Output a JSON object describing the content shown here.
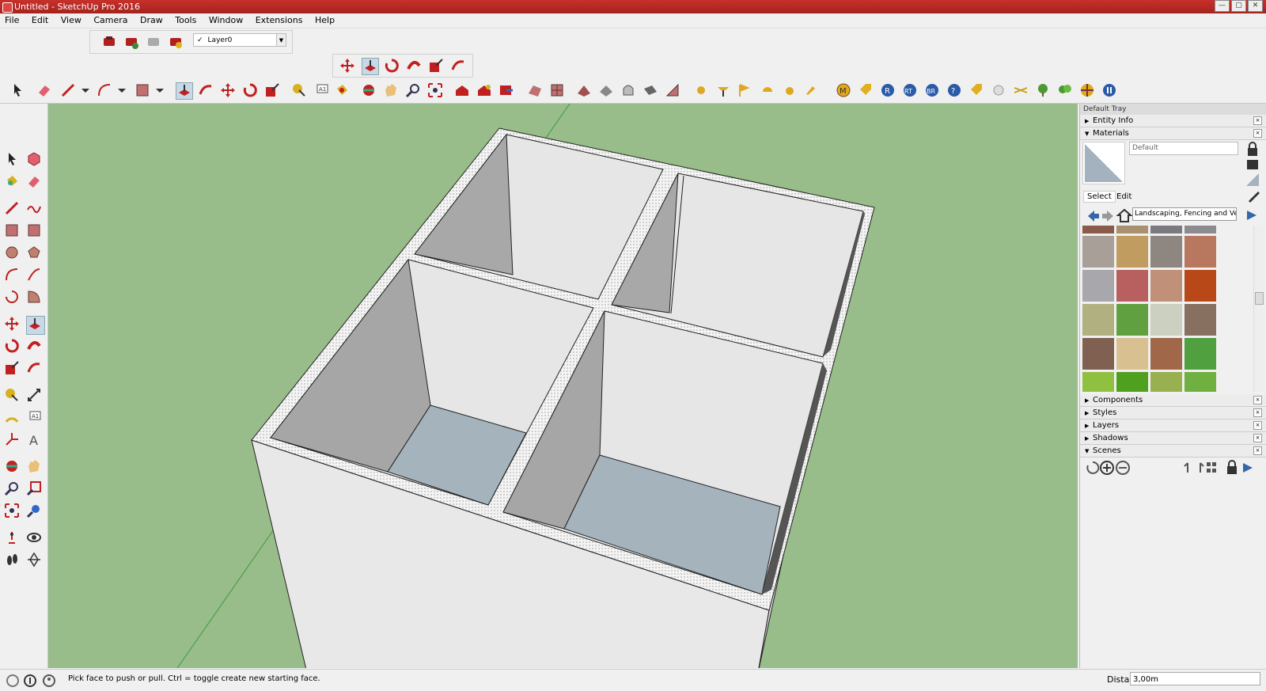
{
  "window": {
    "title": "Untitled - SketchUp Pro 2016"
  },
  "menu": [
    "File",
    "Edit",
    "View",
    "Camera",
    "Draw",
    "Tools",
    "Window",
    "Extensions",
    "Help"
  ],
  "layer_selector": {
    "value": "Layer0",
    "check": "✓"
  },
  "tray": {
    "title": "Default Tray",
    "entity_info": "Entity Info",
    "materials": "Materials",
    "material_name": "Default",
    "select_tab": "Select",
    "edit_tab": "Edit",
    "collection": "Landscaping, Fencing and Ve",
    "components": "Components",
    "styles": "Styles",
    "layers": "Layers",
    "shadows": "Shadows",
    "scenes": "Scenes"
  },
  "swatch_colors": [
    "#8a5a4a",
    "#a89070",
    "#7a7a80",
    "#8c8c90",
    "#a8a098",
    "#c09c60",
    "#8e8680",
    "#b87860",
    "#a8a8ac",
    "#b86060",
    "#c09078",
    "#b84818",
    "#b0b080",
    "#60a040",
    "#ccd0c0",
    "#887060",
    "#806050",
    "#d8c090",
    "#a06848",
    "#50a040",
    "#90c040",
    "#50a020",
    "#98b050",
    "#70b040"
  ],
  "status": {
    "message": "Pick face to push or pull.  Ctrl = toggle create new starting face.",
    "distance_label": "Distance",
    "distance_value": "3,00m"
  },
  "colors": {
    "viewport_bg": "#99bd8a",
    "titlebar": "#b8281f",
    "wall": "#e8e8e8",
    "floor": "#a4b3bc",
    "shade": "#a6a6a6"
  }
}
